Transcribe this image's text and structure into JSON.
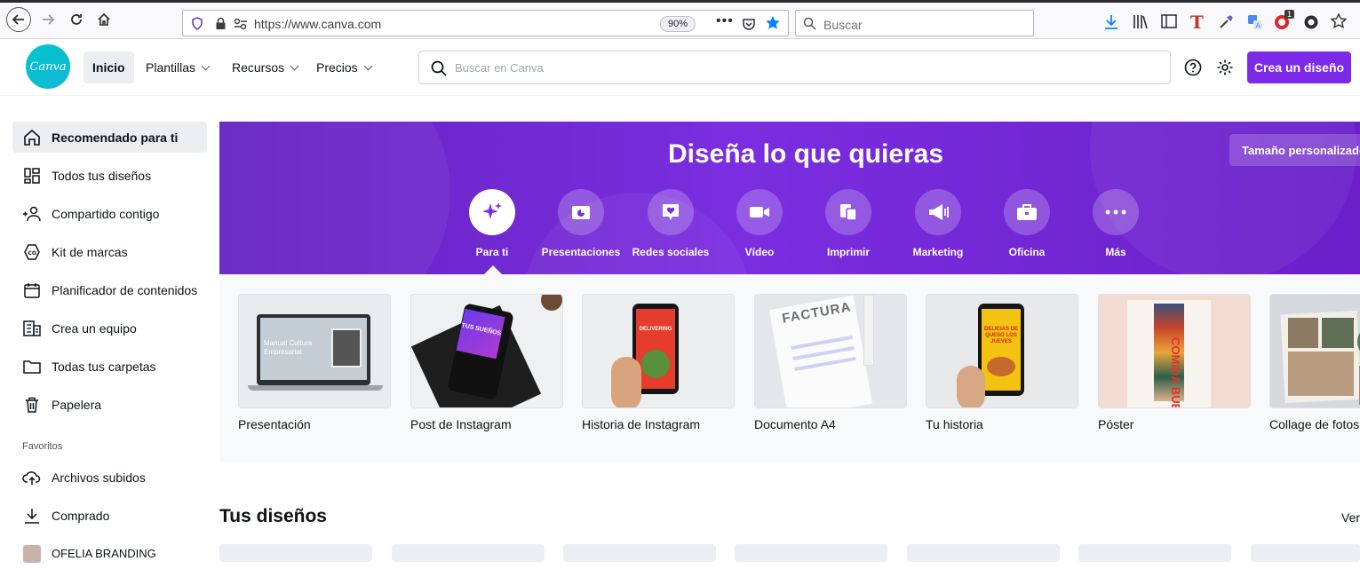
{
  "browser": {
    "url": "https://www.canva.com",
    "zoom": "90%",
    "search_placeholder": "Buscar",
    "badge_count": "1"
  },
  "header": {
    "logo_text": "Canva",
    "nav": [
      "Inicio",
      "Plantillas",
      "Recursos",
      "Precios"
    ],
    "search_placeholder": "Buscar en Canva",
    "create_label": "Crea un diseño"
  },
  "sidebar": {
    "items": [
      {
        "label": "Recomendado para ti",
        "icon": "home-icon"
      },
      {
        "label": "Todos tus diseños",
        "icon": "grid-icon"
      },
      {
        "label": "Compartido contigo",
        "icon": "people-icon"
      },
      {
        "label": "Kit de marcas",
        "icon": "brand-icon"
      },
      {
        "label": "Planificador de contenidos",
        "icon": "calendar-icon"
      },
      {
        "label": "Crea un equipo",
        "icon": "building-icon"
      },
      {
        "label": "Todas tus carpetas",
        "icon": "folder-icon"
      },
      {
        "label": "Papelera",
        "icon": "trash-icon"
      }
    ],
    "favorites_title": "Favoritos",
    "favorites": [
      {
        "label": "Archivos subidos",
        "icon": "upload-cloud-icon"
      },
      {
        "label": "Comprado",
        "icon": "download-icon"
      },
      {
        "label": "OFELIA BRANDING",
        "icon": "thumbnail-icon"
      }
    ]
  },
  "hero": {
    "title": "Diseña lo que quieras",
    "custom_size_label": "Tamaño personalizado",
    "categories": [
      {
        "label": "Para ti",
        "icon": "sparkle-icon"
      },
      {
        "label": "Presentaciones",
        "icon": "presentation-icon"
      },
      {
        "label": "Redes sociales",
        "icon": "heart-bubble-icon"
      },
      {
        "label": "Vídeo",
        "icon": "video-icon"
      },
      {
        "label": "Imprimir",
        "icon": "print-icon"
      },
      {
        "label": "Marketing",
        "icon": "megaphone-icon"
      },
      {
        "label": "Oficina",
        "icon": "briefcase-icon"
      },
      {
        "label": "Más",
        "icon": "more-icon"
      }
    ]
  },
  "templates": [
    {
      "label": "Presentación",
      "thumb_text": "Manual Cultura Empresarial"
    },
    {
      "label": "Post de Instagram",
      "thumb_text": "TUS SUEÑOS"
    },
    {
      "label": "Historia de Instagram",
      "thumb_text": "DELIVERING"
    },
    {
      "label": "Documento A4",
      "thumb_text": "FACTURA"
    },
    {
      "label": "Tu historia",
      "thumb_text": "DELICIAS DE QUESO LOS JUEVES"
    },
    {
      "label": "Póster",
      "thumb_text": "COMIDA BUENA"
    },
    {
      "label": "Collage de fotos",
      "thumb_text": ""
    }
  ],
  "designs": {
    "title": "Tus diseños",
    "see_all": "Ver"
  },
  "colors": {
    "brand_purple": "#7d2ae8",
    "hero_purple": "#6a24d0",
    "teal_logo": "#00c4cc"
  }
}
